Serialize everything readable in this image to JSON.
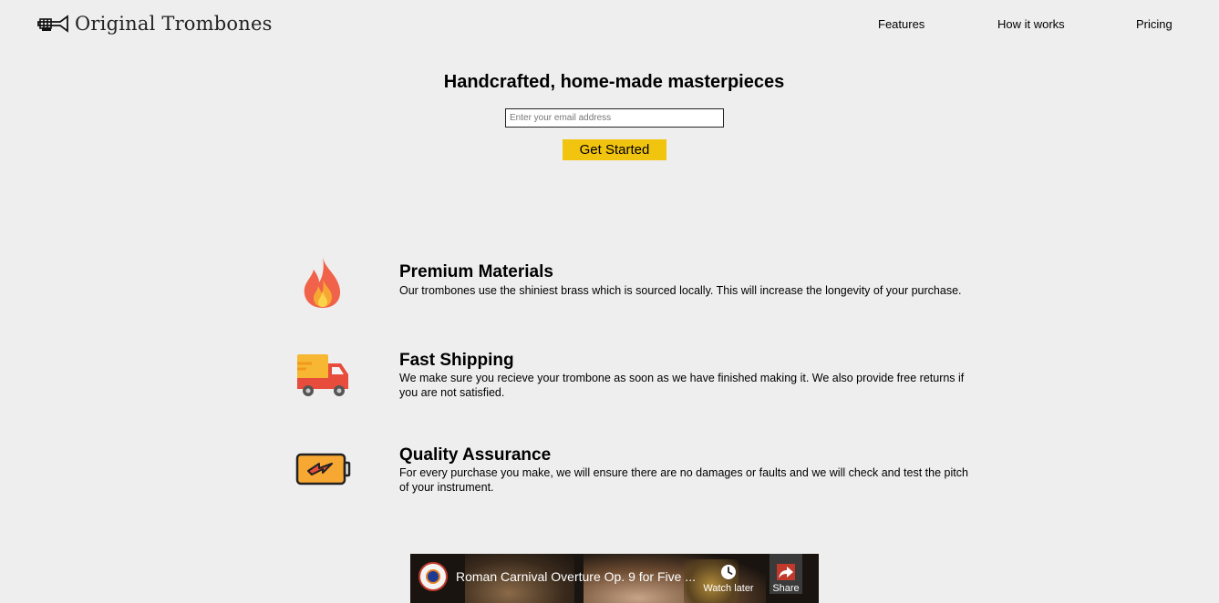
{
  "brand": {
    "name": "Original Trombones"
  },
  "nav": {
    "items": [
      {
        "label": "Features"
      },
      {
        "label": "How it works"
      },
      {
        "label": "Pricing"
      }
    ]
  },
  "hero": {
    "title": "Handcrafted, home-made masterpieces",
    "email_placeholder": "Enter your email address",
    "cta_label": "Get Started",
    "cta_color": "#f1c40f"
  },
  "features": [
    {
      "icon": "fire-icon",
      "title": "Premium Materials",
      "description": "Our trombones use the shiniest brass which is sourced locally. This will increase the longevity of your purchase."
    },
    {
      "icon": "truck-icon",
      "title": "Fast Shipping",
      "description": "We make sure you recieve your trombone as soon as we have finished making it. We also provide free returns if you are not satisfied."
    },
    {
      "icon": "battery-icon",
      "title": "Quality Assurance",
      "description": "For every purchase you make, we will ensure there are no damages or faults and we will check and test the pitch of your instrument."
    }
  ],
  "video": {
    "title": "Roman Carnival Overture Op. 9 for Five ...",
    "watch_later_label": "Watch later",
    "share_label": "Share"
  }
}
